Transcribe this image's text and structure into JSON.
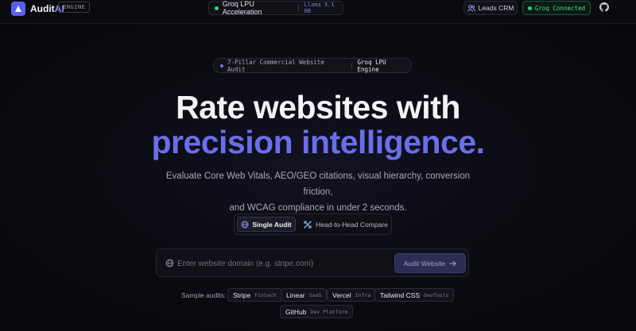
{
  "header": {
    "brand_main": "Audit",
    "brand_accent": "AI",
    "engine_badge": "ENGINE",
    "acceleration_label": "Groq LPU Acceleration",
    "model_label": "Llama 3.1 8B",
    "leads_label": "Leads CRM",
    "groq_status": "Groq Connected"
  },
  "hero": {
    "eyebrow_left": "7-Pillar Commercial Website Audit",
    "eyebrow_right": "Groq LPU Engine",
    "title_line1": "Rate websites with",
    "title_line2": "precision intelligence.",
    "subtitle_line1": "Evaluate Core Web Vitals, AEO/GEO citations, visual hierarchy, conversion friction,",
    "subtitle_line2": "and WCAG compliance in under 2 seconds."
  },
  "modes": {
    "single": "Single Audit",
    "compare": "Head-to-Head Compare",
    "selected": "single"
  },
  "search": {
    "placeholder": "Enter website domain (e.g. stripe.com)",
    "value": "",
    "button_label": "Audit Website"
  },
  "samples": {
    "label": "Sample audits:",
    "items": [
      {
        "name": "Stripe",
        "tag": "Fintech"
      },
      {
        "name": "Linear",
        "tag": "SaaS"
      },
      {
        "name": "Vercel",
        "tag": "Infra"
      },
      {
        "name": "Tailwind CSS",
        "tag": "DevTools"
      },
      {
        "name": "GitHub",
        "tag": "Dev Platform"
      }
    ]
  },
  "colors": {
    "accent": "#6a6ee9",
    "success": "#3fe08a",
    "background": "#0b0b12"
  },
  "icons": {
    "logo": "logo-mark-icon",
    "leads": "users-icon",
    "github": "github-icon",
    "single": "globe-icon",
    "compare": "swap-icon",
    "search": "globe-icon",
    "button": "arrow-right-icon"
  }
}
